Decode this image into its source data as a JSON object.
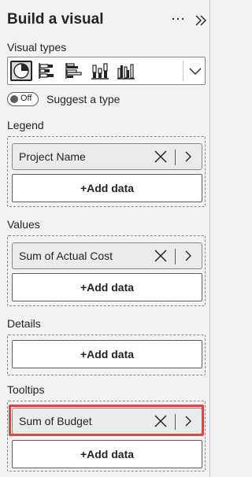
{
  "header": {
    "title": "Build a visual",
    "more_icon": "more-options-icon",
    "collapse_icon": "double-chevron-right-icon"
  },
  "visual_types": {
    "label": "Visual types",
    "icons": [
      "pie-chart-icon",
      "stacked-bar-chart-icon",
      "clustered-bar-chart-icon",
      "stacked-column-chart-icon",
      "clustered-column-chart-icon"
    ],
    "selected_index": 0
  },
  "suggest": {
    "toggle_text": "Off",
    "label": "Suggest a type",
    "on": false
  },
  "wells": {
    "legend": {
      "label": "Legend",
      "field": "Project Name",
      "add": "+Add data"
    },
    "values": {
      "label": "Values",
      "field": "Sum of Actual Cost",
      "add": "+Add data"
    },
    "details": {
      "label": "Details",
      "add": "+Add data"
    },
    "tooltips": {
      "label": "Tooltips",
      "field": "Sum of Budget",
      "add": "+Add data"
    }
  },
  "colors": {
    "highlight": "#d9474b",
    "background": "#f3f2f1"
  }
}
